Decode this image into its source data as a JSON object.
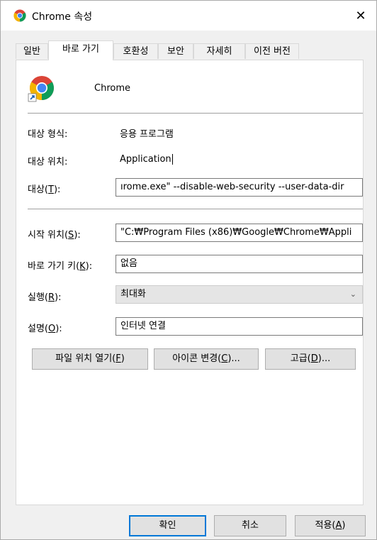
{
  "window": {
    "title": "Chrome 속성",
    "close_glyph": "✕"
  },
  "tabs": [
    {
      "label": "일반",
      "active": false
    },
    {
      "label": "바로 가기",
      "active": true
    },
    {
      "label": "호환성",
      "active": false
    },
    {
      "label": "보안",
      "active": false
    },
    {
      "label": "자세히",
      "active": false
    },
    {
      "label": "이전 버전",
      "active": false
    }
  ],
  "app": {
    "name": "Chrome",
    "icon": "chrome-icon"
  },
  "fields": {
    "target_type": {
      "label": "대상 형식:",
      "value": "응용 프로그램"
    },
    "target_location": {
      "label": "대상 위치:",
      "value": "Application"
    },
    "target": {
      "label": "대상(T):",
      "label_pre": "대상(",
      "label_key": "T",
      "label_post": "):",
      "value": "ırome.exe\" --disable-web-security --user-data-dir"
    },
    "start_in": {
      "label_pre": "시작 위치(",
      "label_key": "S",
      "label_post": "):",
      "value": "\"C:₩Program Files (x86)₩Google₩Chrome₩Appli"
    },
    "shortcut_key": {
      "label_pre": "바로 가기 키(",
      "label_key": "K",
      "label_post": "):",
      "value": "없음"
    },
    "run": {
      "label_pre": "실행(",
      "label_key": "R",
      "label_post": "):",
      "value": "최대화"
    },
    "comment": {
      "label_pre": "설명(",
      "label_key": "O",
      "label_post": "):",
      "value": "인터넷 연결"
    }
  },
  "action_buttons": {
    "open_location": {
      "pre": "파일 위치 열기(",
      "key": "F",
      "post": ")"
    },
    "change_icon": {
      "pre": "아이콘 변경(",
      "key": "C",
      "post": ")..."
    },
    "advanced": {
      "pre": "고급(",
      "key": "D",
      "post": ")..."
    }
  },
  "footer": {
    "ok": "확인",
    "cancel": "취소",
    "apply_pre": "적용(",
    "apply_key": "A",
    "apply_post": ")"
  },
  "colors": {
    "accent": "#0078d7",
    "panel": "#ffffff",
    "dialog_bg": "#f0f0f0"
  }
}
